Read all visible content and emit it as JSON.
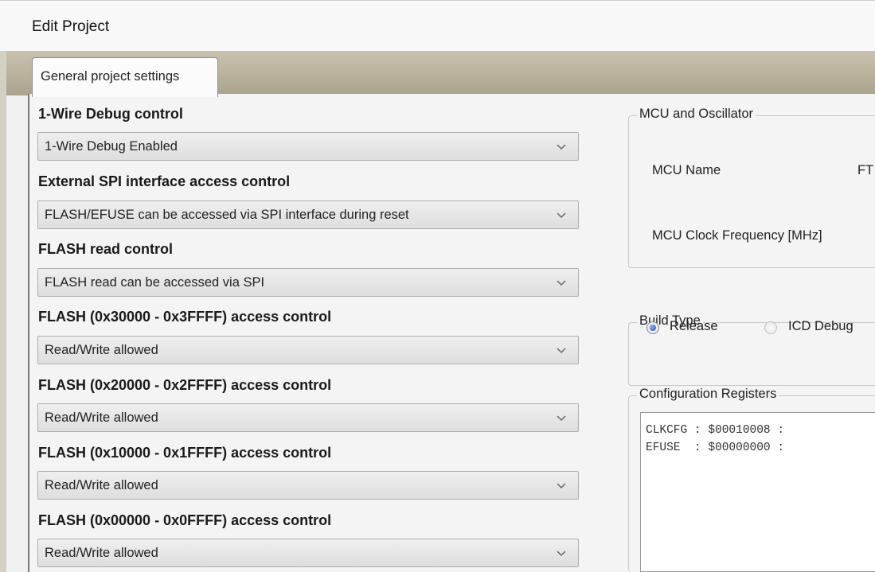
{
  "window": {
    "title": "Edit Project"
  },
  "tabs": [
    {
      "label": "General project settings"
    }
  ],
  "settings": [
    {
      "label": "1-Wire Debug control",
      "value": "1-Wire Debug Enabled"
    },
    {
      "label": "External SPI interface access control",
      "value": "FLASH/EFUSE can be accessed via SPI interface during reset"
    },
    {
      "label": "FLASH read control",
      "value": "FLASH read can be accessed via SPI"
    },
    {
      "label": "FLASH (0x30000 - 0x3FFFF) access control",
      "value": "Read/Write allowed"
    },
    {
      "label": "FLASH (0x20000 - 0x2FFFF) access control",
      "value": "Read/Write allowed"
    },
    {
      "label": "FLASH (0x10000 - 0x1FFFF) access control",
      "value": "Read/Write allowed"
    },
    {
      "label": "FLASH (0x00000 - 0x0FFFF) access control",
      "value": "Read/Write allowed"
    }
  ],
  "mcu": {
    "group_label": "MCU and Oscillator",
    "name_label": "MCU Name",
    "name_value": "FT",
    "clock_label": "MCU Clock Frequency [MHz]"
  },
  "build": {
    "group_label": "Build Type",
    "options": [
      {
        "label": "Release",
        "selected": true
      },
      {
        "label": "ICD Debug",
        "selected": false
      }
    ]
  },
  "config": {
    "group_label": "Configuration Registers",
    "lines": [
      "CLKCFG : $00010008 :",
      "EFUSE  : $00000000 :"
    ]
  },
  "icons": {
    "dropdown": "chevron-down-icon",
    "radio_selected": "radio-selected-icon"
  },
  "colors": {
    "tabstrip": "#b9b39e",
    "panel": "#f4f4f4",
    "radio_accent": "#1d56c2"
  }
}
